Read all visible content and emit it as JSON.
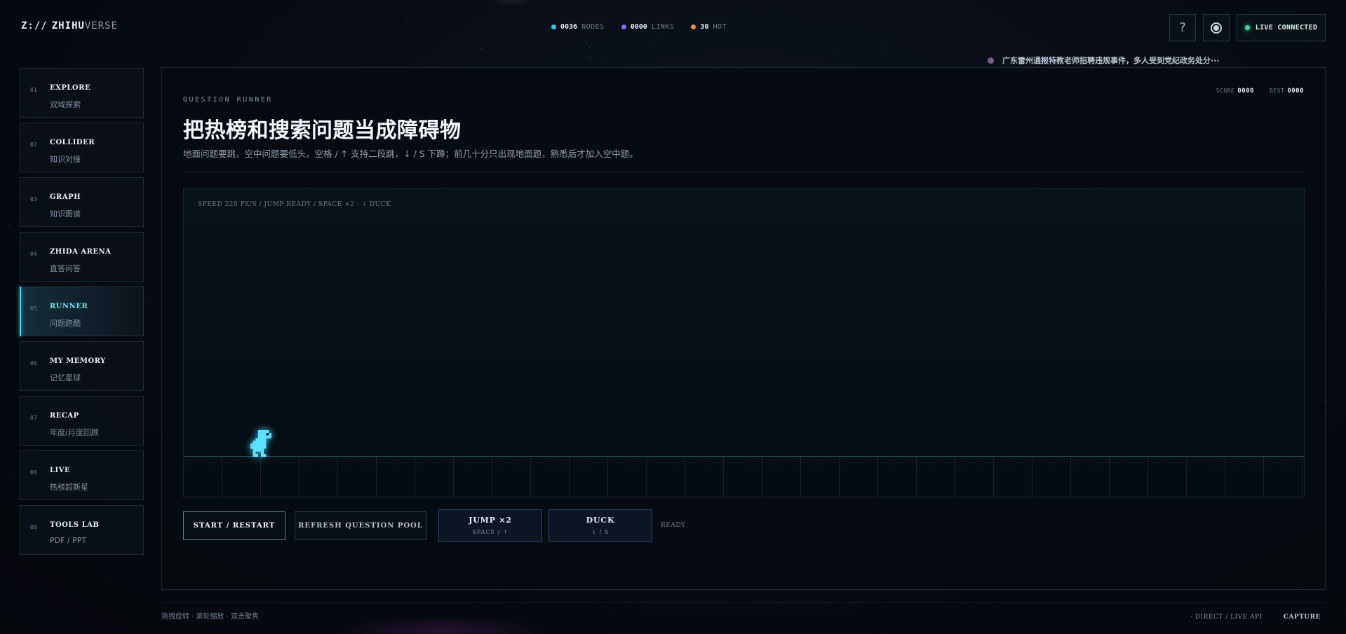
{
  "app": {
    "logo_mark": "Z://",
    "logo_bold": "ZHIHU",
    "logo_light": "VERSE"
  },
  "header": {
    "stats": [
      {
        "num": "0036",
        "label": "NODES",
        "color": "#39c4e3"
      },
      {
        "num": "0000",
        "label": "LINKS",
        "color": "#8b6cf0"
      },
      {
        "num": "30",
        "label": "HOT",
        "color": "#f08a3c"
      }
    ],
    "help_label": "?",
    "theme_icon": "theme-toggle-icon",
    "live_label": "LIVE CONNECTED",
    "live_color": "#3ddc97",
    "ticker_text": "广东雷州通报特教老师招聘违规事件，多人受到党纪政务处分···"
  },
  "sidebar": {
    "items": [
      {
        "idx": "01",
        "en": "EXPLORE",
        "zh": "双域探索"
      },
      {
        "idx": "02",
        "en": "COLLIDER",
        "zh": "知识对撞"
      },
      {
        "idx": "03",
        "en": "GRAPH",
        "zh": "知识图谱"
      },
      {
        "idx": "04",
        "en": "ZHIDA ARENA",
        "zh": "直答问答"
      },
      {
        "idx": "05",
        "en": "RUNNER",
        "zh": "问题跑酷",
        "active": true
      },
      {
        "idx": "06",
        "en": "MY MEMORY",
        "zh": "记忆星球"
      },
      {
        "idx": "07",
        "en": "RECAP",
        "zh": "年度/月度回顾"
      },
      {
        "idx": "08",
        "en": "LIVE",
        "zh": "热榜超新星"
      },
      {
        "idx": "09",
        "en": "TOOLS LAB",
        "zh": "PDF / PPT"
      }
    ],
    "accent_color": "#4fd8e8"
  },
  "main": {
    "eyebrow": "QUESTION RUNNER",
    "title": "把热榜和搜索问题当成障碍物",
    "subtitle": "地面问题要跳，空中问题要低头。空格 / ↑ 支持二段跳，↓ / S 下蹲；前几十分只出现地面题，熟悉后才加入空中题。",
    "score_label": "SCORE",
    "score_value": "0000",
    "best_label": "BEST",
    "best_value": "0000",
    "game": {
      "hud": "SPEED 220 PX/S  /  JUMP READY  /  SPACE ×2 · ↓ DUCK",
      "player_icon": "pixel-dino-icon",
      "player_color": "#5fe0ff"
    },
    "controls": {
      "start": "START / RESTART",
      "refresh": "REFRESH QUESTION POOL",
      "jump_title": "JUMP ×2",
      "jump_keys": "SPACE / ↑",
      "duck_title": "DUCK",
      "duck_keys": "↓ / S",
      "status": "READY"
    }
  },
  "footer": {
    "hints": "拖拽旋转 · 滚轮缩放 · 双击聚焦",
    "mode": "· DIRECT / LIVE API",
    "capture": "CAPTURE"
  }
}
